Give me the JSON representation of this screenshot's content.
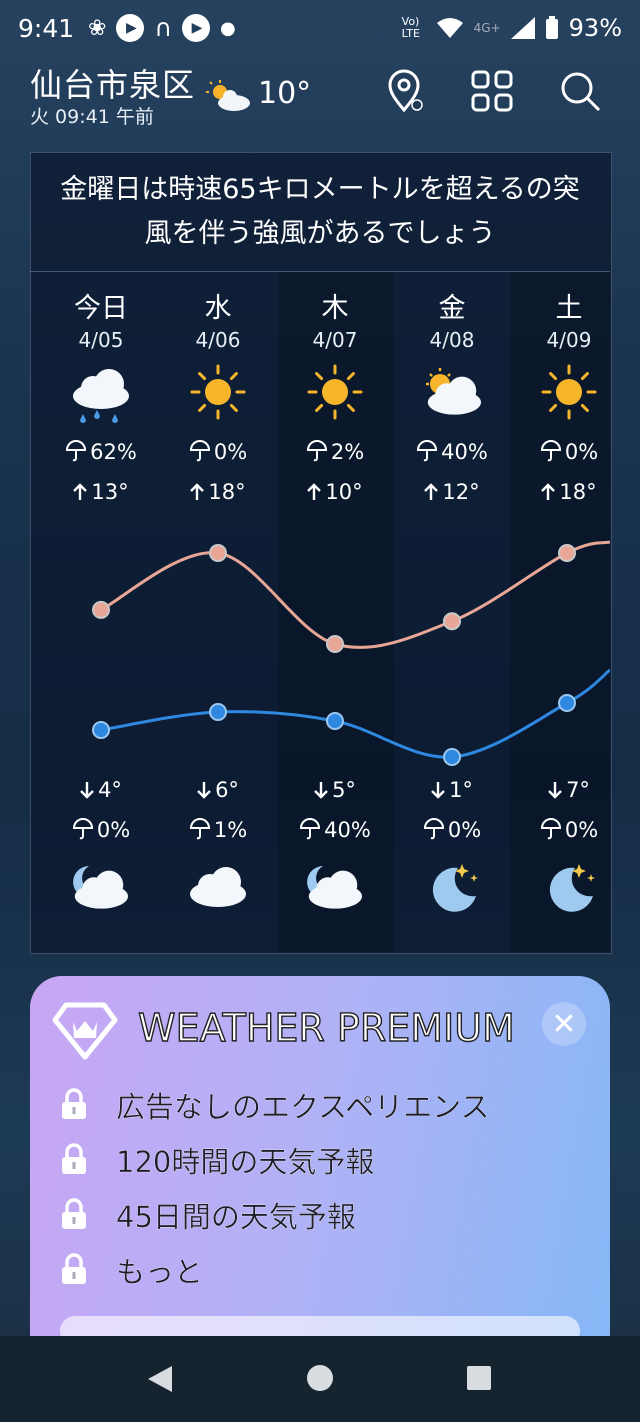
{
  "status_bar": {
    "time": "9:41",
    "network_label": "Vo) LTE",
    "signal_label": "4G+",
    "battery": "93%"
  },
  "header": {
    "city": "仙台市泉区",
    "subtitle": "火 09:41 午前",
    "current_temp": "10°",
    "icons": [
      "location-info-icon",
      "grid-icon",
      "search-icon"
    ]
  },
  "alert_text": "金曜日は時速65キロメートルを超えるの突風を伴う強風があるでしょう",
  "days": [
    {
      "name": "今日",
      "date": "4/05",
      "day_icon": "rain-cloud",
      "day_precip": "62%",
      "high": "13°",
      "low": "4°",
      "night_precip": "0%",
      "night_icon": "cloud-moon"
    },
    {
      "name": "水",
      "date": "4/06",
      "day_icon": "sun",
      "day_precip": "0%",
      "high": "18°",
      "low": "6°",
      "night_precip": "1%",
      "night_icon": "cloud"
    },
    {
      "name": "木",
      "date": "4/07",
      "day_icon": "sun",
      "day_precip": "2%",
      "high": "10°",
      "low": "5°",
      "night_precip": "40%",
      "night_icon": "cloud-moon"
    },
    {
      "name": "金",
      "date": "4/08",
      "day_icon": "sun-cloud",
      "day_precip": "40%",
      "high": "12°",
      "low": "1°",
      "night_precip": "0%",
      "night_icon": "moon-stars"
    },
    {
      "name": "土",
      "date": "4/09",
      "day_icon": "sun",
      "day_precip": "0%",
      "high": "18°",
      "low": "7°",
      "night_precip": "0%",
      "night_icon": "moon-stars"
    }
  ],
  "chart_data": {
    "type": "line",
    "categories": [
      "今日",
      "水",
      "木",
      "金",
      "土"
    ],
    "series": [
      {
        "values": [
          13,
          18,
          10,
          12,
          18
        ],
        "color": "#e8a796"
      },
      {
        "values": [
          4,
          6,
          5,
          1,
          7
        ],
        "color": "#2f88e0"
      }
    ]
  },
  "premium": {
    "title": "WEATHER PREMIUM",
    "items": [
      "広告なしのエクスペリエンス",
      "120時間の天気予報",
      "45日間の天気予報",
      "もっと"
    ]
  },
  "nav": {
    "icons": [
      "back-icon",
      "home-icon",
      "recents-icon"
    ]
  }
}
